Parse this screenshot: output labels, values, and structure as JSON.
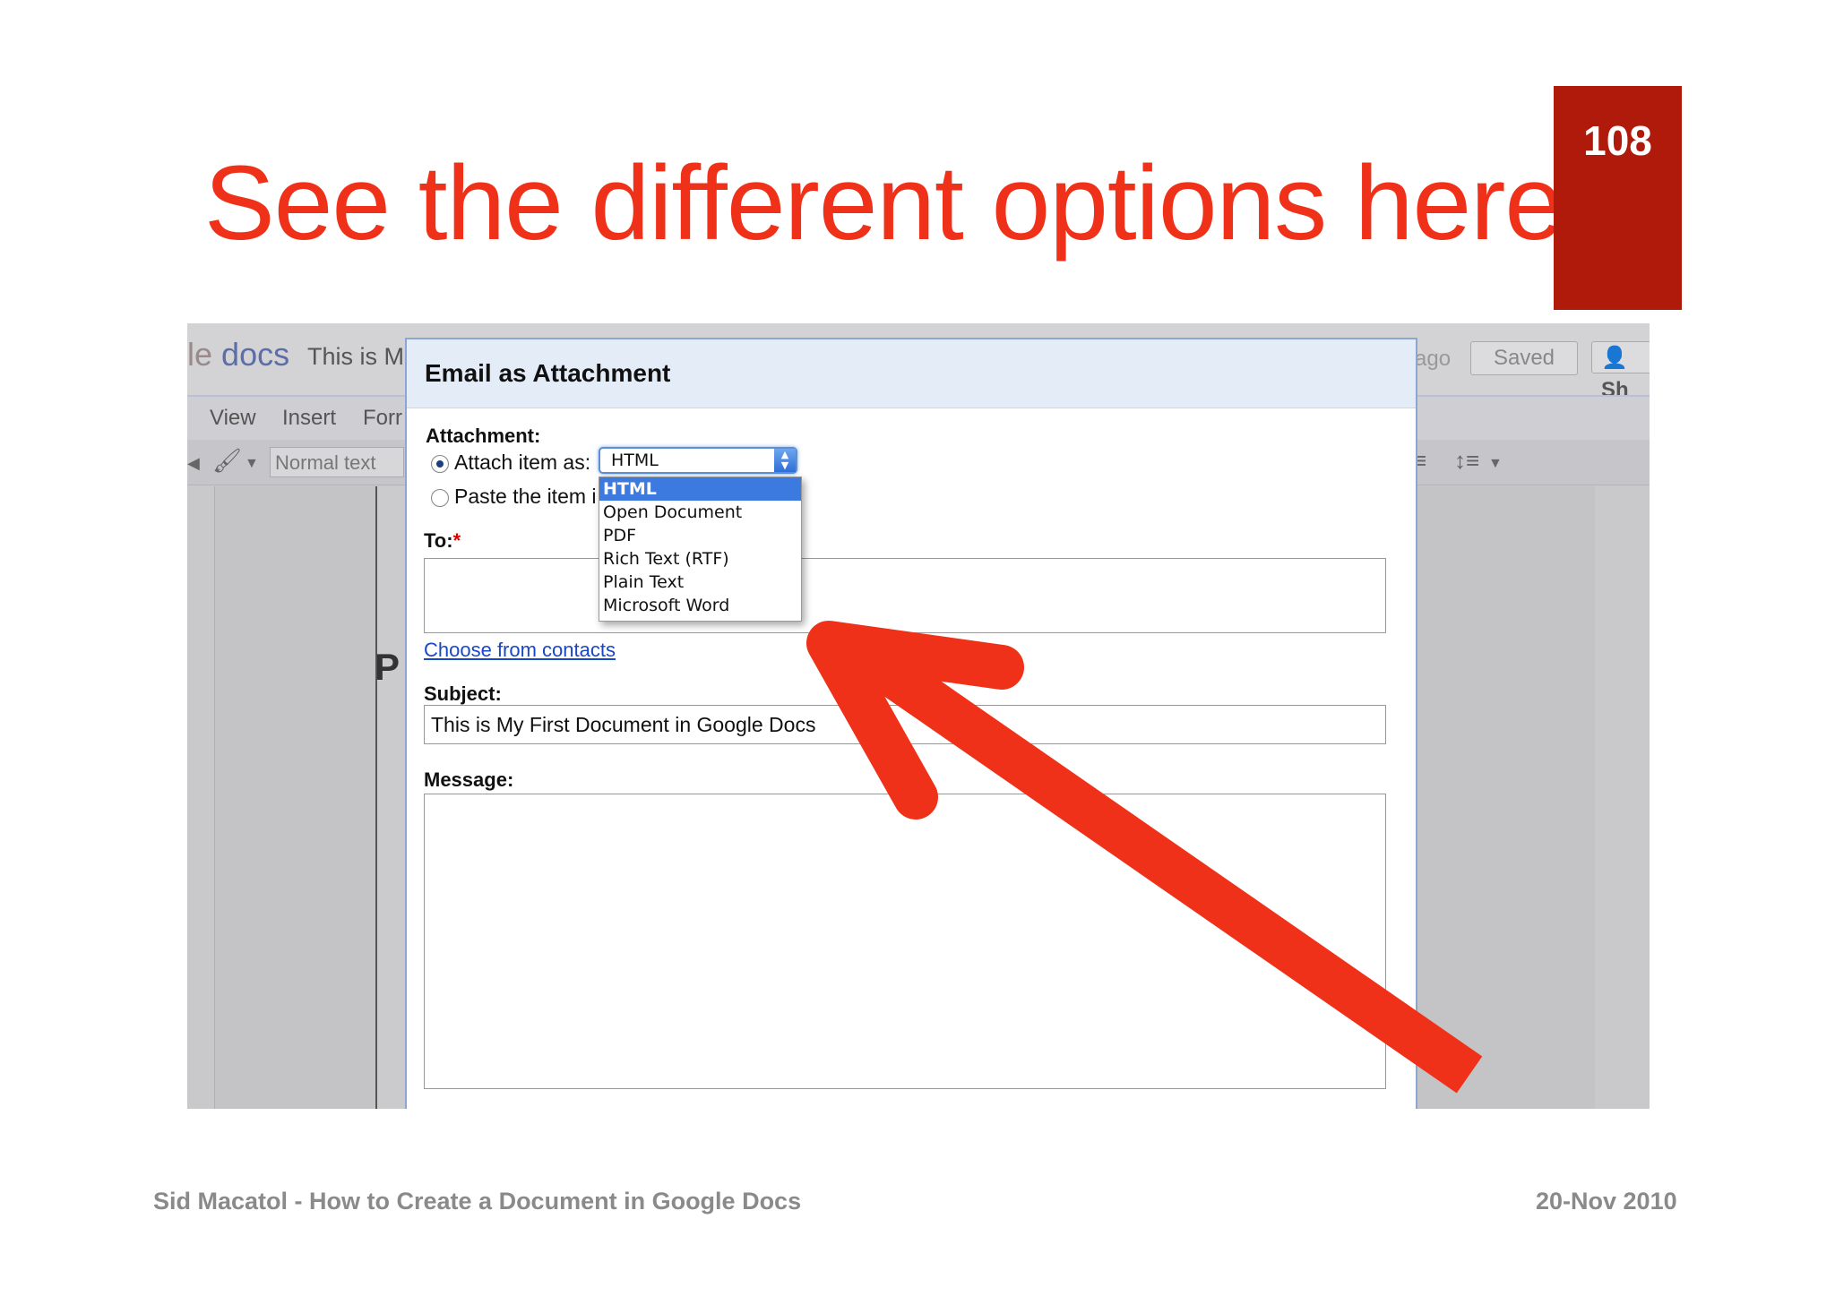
{
  "slide": {
    "title": "See the different options here",
    "page_number": "108",
    "footer_left": "Sid Macatol - How to Create a Document in Google Docs",
    "footer_right": "20-Nov 2010",
    "accent_color": "#f0311a",
    "badge_color": "#b01a0b"
  },
  "background_app": {
    "logo_e": "le",
    "logo_docs": "docs",
    "doc_title": "This is M",
    "saved_ago": "ago",
    "saved_button": "Saved",
    "share_button": "Sh",
    "menu": [
      "View",
      "Insert",
      "Forr"
    ],
    "style_select": "Normal text",
    "page_letter": "P"
  },
  "dialog": {
    "title": "Email as Attachment",
    "attachment_label": "Attachment:",
    "attach_as_label": "Attach item as:",
    "paste_label": "Paste the item i",
    "selected_format": "HTML",
    "format_options": [
      "HTML",
      "Open Document",
      "PDF",
      "Rich Text (RTF)",
      "Plain Text",
      "Microsoft Word"
    ],
    "to_label": "To:",
    "required_mark": "*",
    "choose_contacts": "Choose from contacts",
    "subject_label": "Subject:",
    "subject_value": "This is My First Document in Google Docs",
    "message_label": "Message:"
  }
}
